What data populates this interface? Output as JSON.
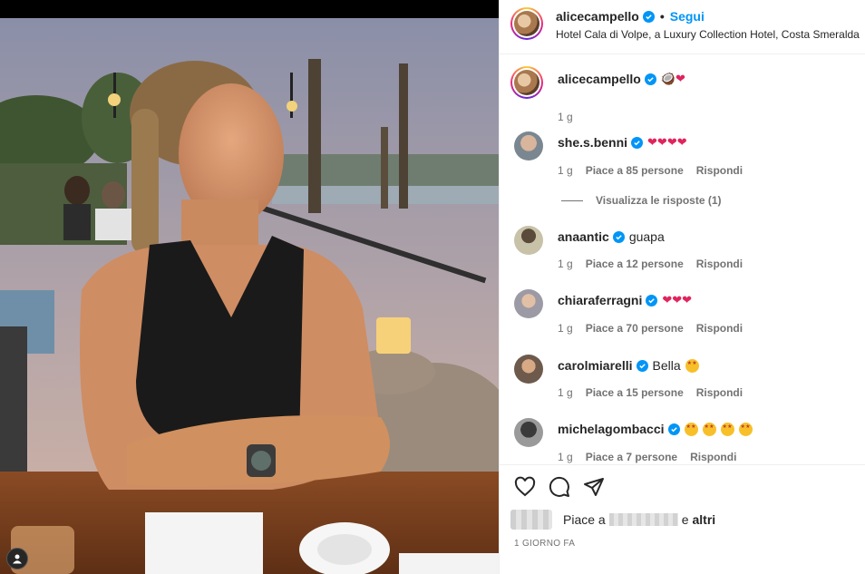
{
  "header": {
    "username": "alicecampello",
    "separator": "•",
    "follow_label": "Segui",
    "location": "Hotel Cala di Volpe, a Luxury Collection Hotel, Costa Smeralda"
  },
  "caption": {
    "username": "alicecampello",
    "emojis": "🥥❤",
    "time": "1 g"
  },
  "comments": [
    {
      "username": "she.s.benni",
      "verified": true,
      "text": "❤❤❤❤",
      "time": "1 g",
      "likes": "Piace a 85 persone",
      "reply": "Rispondi",
      "view_replies": "Visualizza le risposte (1)"
    },
    {
      "username": "anaantic",
      "verified": true,
      "text": "guapa",
      "time": "1 g",
      "likes": "Piace a 12 persone",
      "reply": "Rispondi"
    },
    {
      "username": "chiaraferragni",
      "verified": true,
      "text": "❤❤❤",
      "time": "1 g",
      "likes": "Piace a 70 persone",
      "reply": "Rispondi"
    },
    {
      "username": "carolmiarelli",
      "verified": true,
      "text": "Bella",
      "time": "1 g",
      "likes": "Piace a 15 persone",
      "reply": "Rispondi"
    },
    {
      "username": "michelagombacci",
      "verified": true,
      "text": "",
      "time": "1 g",
      "likes": "Piace a 7 persone",
      "reply": "Rispondi"
    }
  ],
  "actions": {
    "like_icon": "heart-outline-icon",
    "comment_icon": "comment-bubble-icon",
    "share_icon": "paper-plane-icon"
  },
  "likes_summary": {
    "prefix": "Piace a",
    "conjunction": "e",
    "others": "altri"
  },
  "post_date": "1 GIORNO FA",
  "colors": {
    "accent_blue": "#0095f6",
    "text_primary": "#262626",
    "text_secondary": "#737373",
    "heart_red": "#e0245e"
  }
}
